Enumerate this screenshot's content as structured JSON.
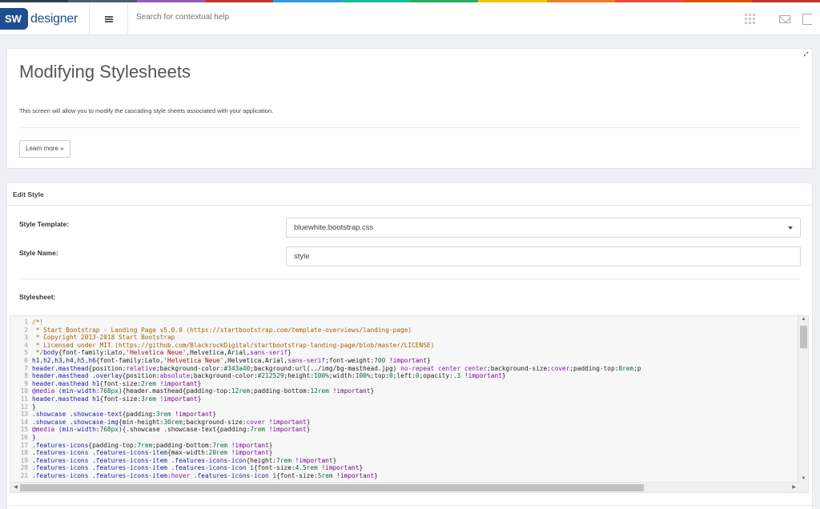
{
  "brand": {
    "badge": "SW",
    "name": "designer",
    "strip_colors": [
      "#2d3e50",
      "#4a5d73",
      "#9b59b6",
      "#c0392b",
      "#3498db",
      "#1abc9c",
      "#27ae60",
      "#f1c40f",
      "#e67e22",
      "#e74c3c",
      "#d35400",
      "#c0392b"
    ]
  },
  "header": {
    "search_placeholder": "Search for contextual help",
    "icons": [
      "grid-icon",
      "mail-icon",
      "exit-icon",
      "menu-icon"
    ]
  },
  "intro": {
    "title": "Modifying Stylesheets",
    "description": "This screen will allow you to modify the cascading style sheets associated with your application.",
    "learn_more": "Learn more »",
    "expand_glyph": "⤢"
  },
  "edit": {
    "heading": "Edit Style",
    "template_label": "Style Template:",
    "template_value": "bluewhite.bootstrap.css",
    "name_label": "Style Name:",
    "name_value": "style",
    "stylesheet_label": "Stylesheet:"
  },
  "code_lines": [
    "/*!",
    " * Start Bootstrap - Landing Page v5.0.0 (https://startbootstrap.com/template-overviews/landing-page)",
    " * Copyright 2013-2018 Start Bootstrap",
    " * Licensed under MIT (https://github.com/BlackrockDigital/startbootstrap-landing-page/blob/master/LICENSE)",
    " */body{font-family:Lato,'Helvetica Neue',Helvetica,Arial,sans-serif}",
    "h1,h2,h3,h4,h5,h6{font-family:Lato,'Helvetica Neue',Helvetica,Arial,sans-serif;font-weight:700 !important}",
    "header.masthead{position:relative;background-color:#343a40;background:url(../img/bg-masthead.jpg) no-repeat center center;background-size:cover;padding-top:8rem;p",
    "header.masthead .overlay{position:absolute;background-color:#212529;height:100%;width:100%;top:0;left:0;opacity:.3 !important}",
    "header.masthead h1{font-size:2rem !important}",
    "@media (min-width:768px){header.masthead{padding-top:12rem;padding-bottom:12rem !important}",
    "header.masthead h1{font-size:3rem !important}",
    "}",
    ".showcase .showcase-text{padding:3rem !important}",
    ".showcase .showcase-img{min-height:30rem;background-size:cover !important}",
    "@media (min-width:768px){.showcase .showcase-text{padding:7rem !important}",
    "}",
    ".features-icons{padding-top:7rem;padding-bottom:7rem !important}",
    ".features-icons .features-icons-item{max-width:20rem !important}",
    ".features-icons .features-icons-item .features-icons-icon{height:7rem !important}",
    ".features-icons .features-icons-item .features-icons-icon i{font-size:4.5rem !important}",
    ".features-icons .features-icons-item:hover .features-icons-icon i{font-size:5rem !important}"
  ],
  "line_styles": [
    "com",
    "com",
    "com",
    "com",
    "mix",
    "sel",
    "sel",
    "sel",
    "sel",
    "media",
    "sel",
    "plain",
    "sel",
    "sel",
    "media",
    "plain",
    "sel",
    "sel",
    "sel",
    "sel",
    "sel"
  ]
}
